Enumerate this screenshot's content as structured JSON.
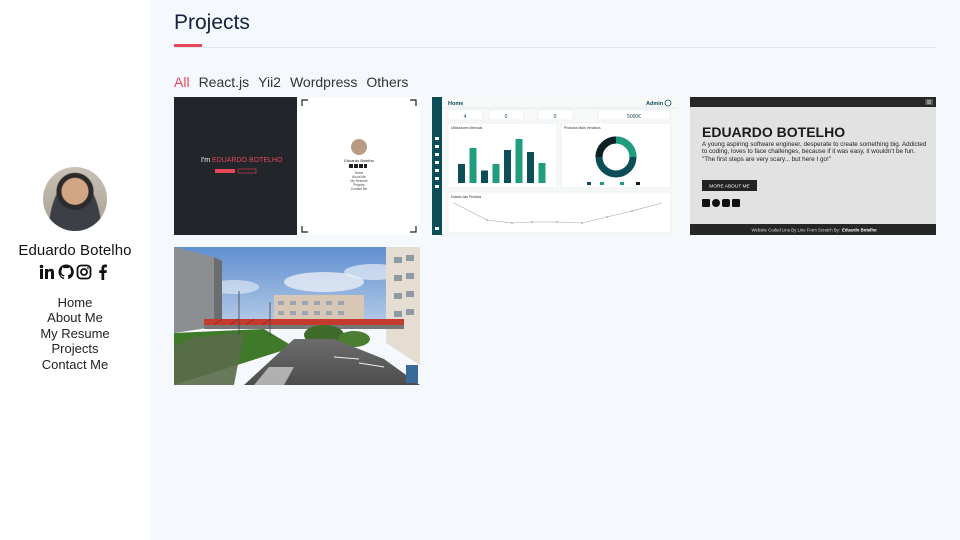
{
  "profile": {
    "name": "Eduardo Botelho",
    "social_icons": [
      "linkedin-icon",
      "github-icon",
      "instagram-icon",
      "facebook-icon"
    ]
  },
  "nav": {
    "items": [
      "Home",
      "About Me",
      "My Resume",
      "Projects",
      "Contact Me"
    ]
  },
  "page": {
    "title": "Projects"
  },
  "filters": {
    "items": [
      "All",
      "React.js",
      "Yii2",
      "Wordpress",
      "Others"
    ],
    "active": "All"
  },
  "colors": {
    "accent": "#e8475a",
    "sidebar_bg": "#ffffff",
    "main_bg": "#f5f8fd",
    "dashboard_teal": "#0d4d57"
  },
  "projects": {
    "p1": {
      "intro_prefix": "I'm",
      "intro_name": "EDUARDO BOTELHO",
      "btn1": "",
      "btn2": "",
      "card_name": "Eduardo Botelho",
      "menu": [
        "Home",
        "About Me",
        "My Resume",
        "Projects",
        "Contact Me"
      ]
    },
    "p2": {
      "header_title": "Home",
      "header_user": "Admin",
      "stats": [
        "4",
        "0",
        "0",
        "5000€"
      ],
      "panel1_title": "Utilizadores Mensais",
      "panel2_title": "Produtos Mais Vendidos",
      "panel3_title": "Estado das Pedidos",
      "bars": [
        38,
        70,
        25,
        38,
        66,
        88,
        62,
        40
      ]
    },
    "p3": {
      "heading": "EDUARDO BOTELHO",
      "tagline": "A young aspiring software engineer, desperate to create something big. Addicted to coding, loves to face challenges, because if it was easy, it wouldn't be fun.",
      "quote": "\"The first steps are very scary... but here I go!\"",
      "button": "MORE ABOUT ME",
      "footer_prefix": "Website Coded Line By Line From Scratch By:",
      "footer_name": "Eduardo Botelho"
    }
  }
}
